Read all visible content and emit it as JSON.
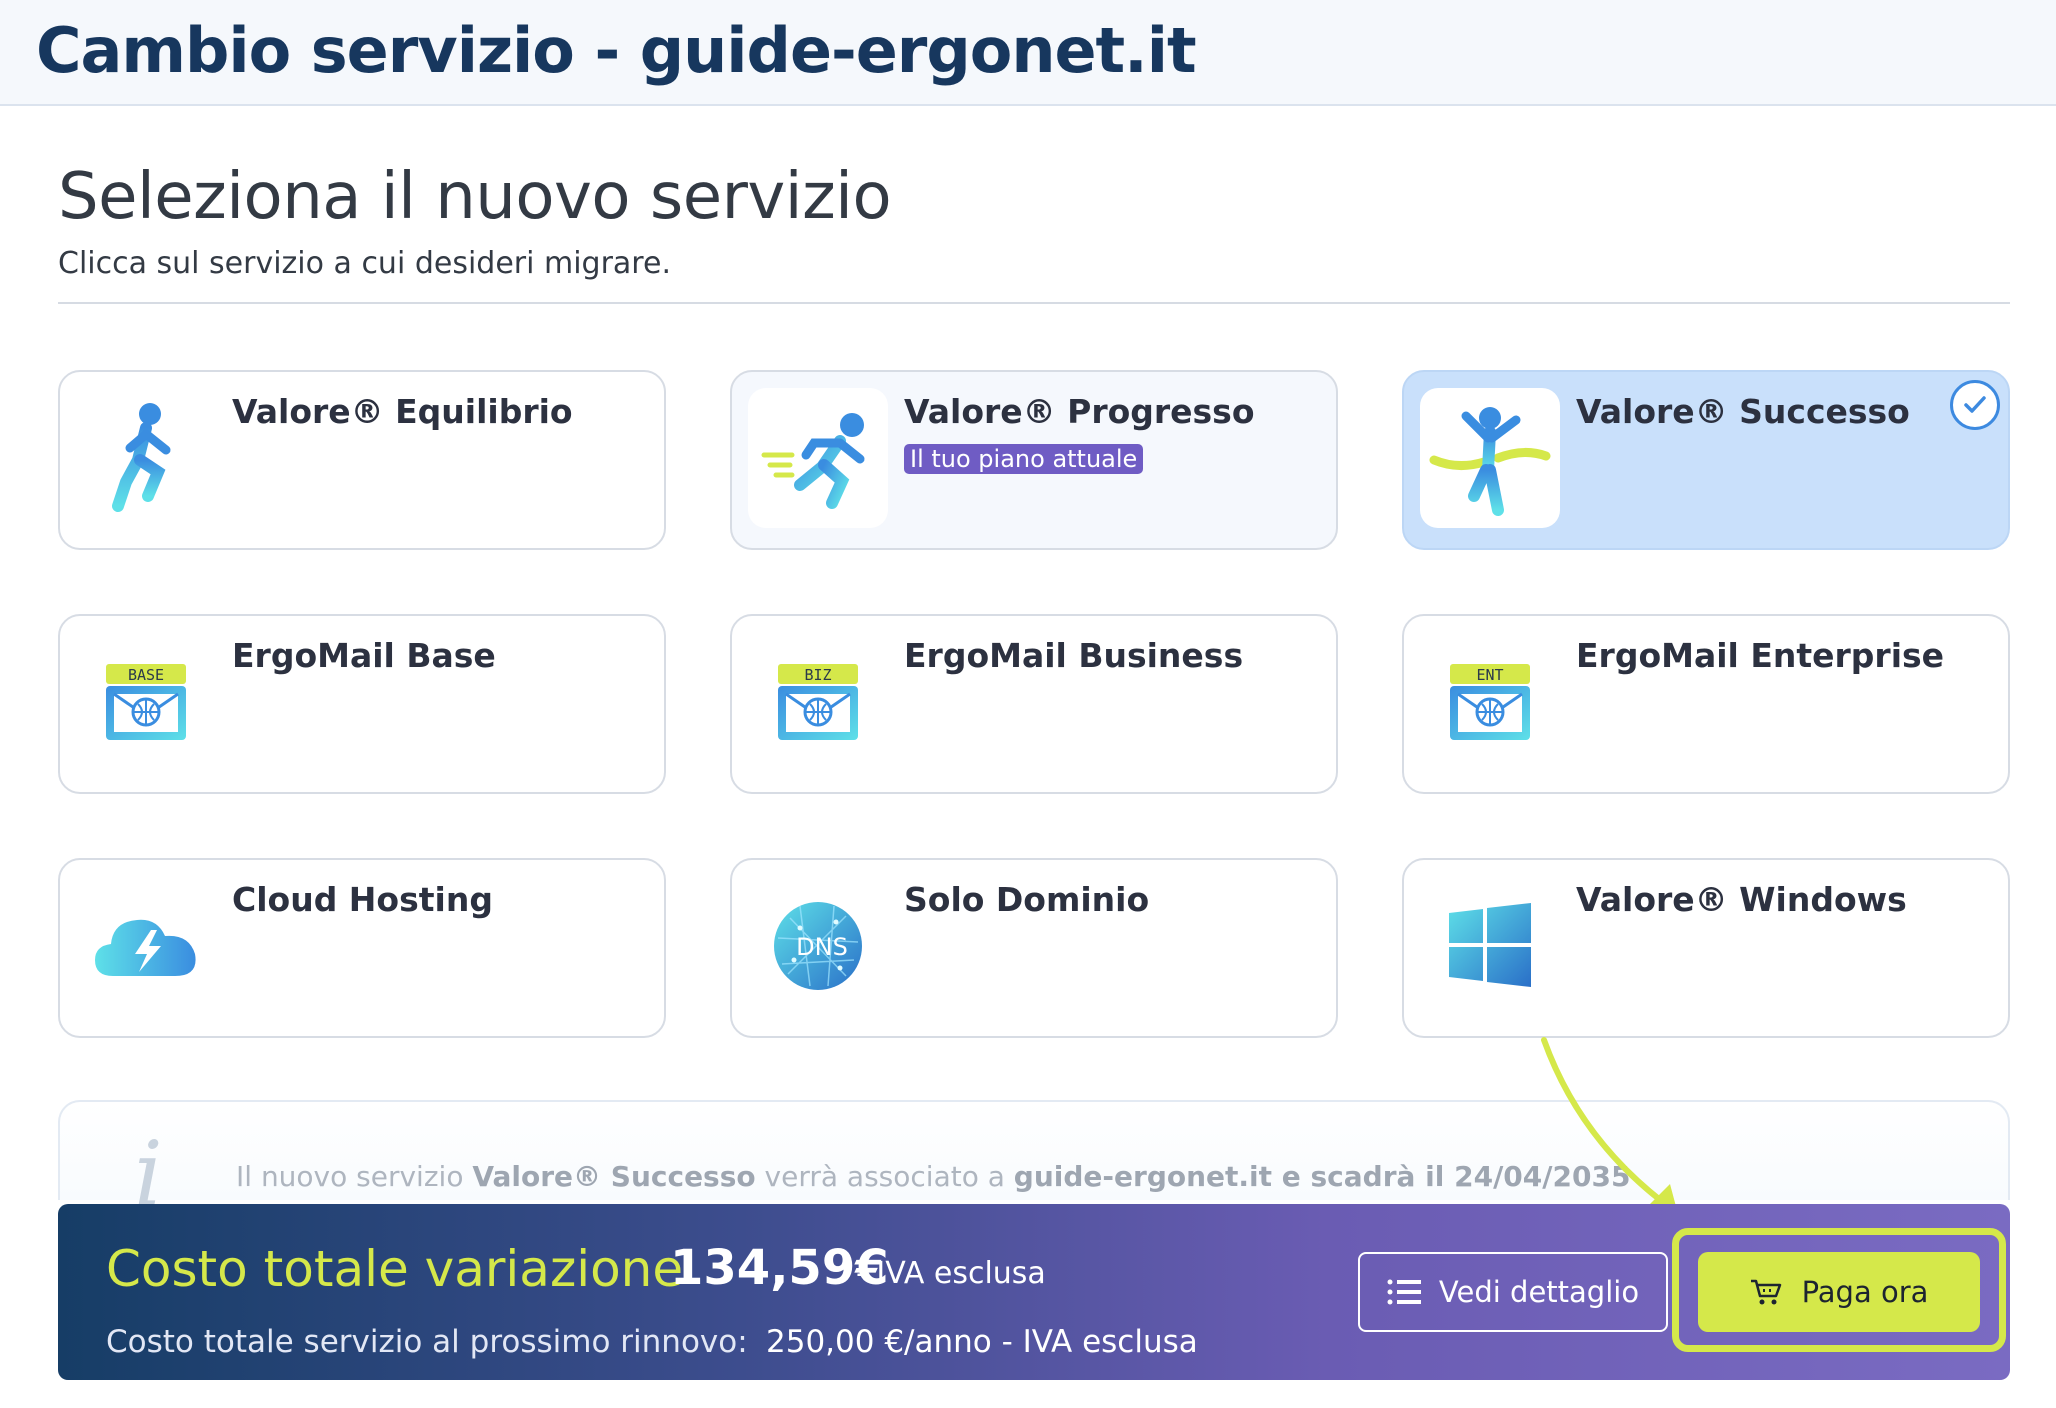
{
  "window": {
    "title": "Cambio servizio - guide-ergonet.it"
  },
  "section": {
    "title": "Seleziona il nuovo servizio",
    "subtitle": "Clicca sul servizio a cui desideri migrare."
  },
  "services": [
    {
      "name": "Valore® Equilibrio",
      "icon": "runner-icon"
    },
    {
      "name": "Valore® Progresso",
      "icon": "sprinter-icon",
      "badge": "Il tuo piano attuale"
    },
    {
      "name": "Valore® Successo",
      "icon": "finish-line-icon",
      "selected": true
    },
    {
      "name": "ErgoMail Base",
      "icon": "mail-icon",
      "tag": "BASE"
    },
    {
      "name": "ErgoMail Business",
      "icon": "mail-icon",
      "tag": "BIZ"
    },
    {
      "name": "ErgoMail Enterprise",
      "icon": "mail-icon",
      "tag": "ENT"
    },
    {
      "name": "Cloud Hosting",
      "icon": "cloud-bolt-icon"
    },
    {
      "name": "Solo Dominio",
      "icon": "globe-dns-icon",
      "tag": "DNS"
    },
    {
      "name": "Valore® Windows",
      "icon": "windows-icon"
    }
  ],
  "info": {
    "p1": "Il nuovo servizio ",
    "service": "Valore® Successo",
    "p2": " verrà associato a ",
    "domain": "guide-ergonet.it e scadrà il 24/04/2035"
  },
  "footer": {
    "total_label": "Costo totale variazione",
    "total_amount": "134,59€",
    "total_vat": "- IVA esclusa",
    "renew_label": "Costo totale servizio al prossimo rinnovo:",
    "renew_value": "250,00 €/anno - IVA esclusa",
    "detail_button": "Vedi dettaglio",
    "pay_button": "Paga ora"
  },
  "colors": {
    "accent_lime": "#d5e84a",
    "brand_navy": "#17375e",
    "badge_purple": "#6f5cc4",
    "selected_card": "#c9e0fb"
  }
}
